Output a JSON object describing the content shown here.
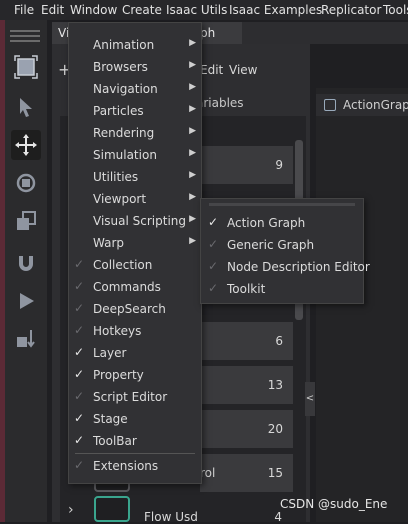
{
  "menubar": {
    "items": [
      "File",
      "Edit",
      "Window",
      "Create",
      "Isaac Utils",
      "Isaac Examples",
      "Replicator",
      "Tools"
    ]
  },
  "window_tab": {
    "title_left": "Vi",
    "title_right": "ph"
  },
  "pane": {
    "menu": [
      "Edit",
      "View"
    ],
    "variables_label": "ariables",
    "row_counts": [
      "9",
      "6",
      "13",
      "20",
      "15"
    ],
    "control_label": "rol",
    "flow_usd": {
      "name": "Flow Usd",
      "count": "4"
    },
    "collapse_arrow": "<"
  },
  "right_panel": {
    "tab_label": "ActionGraph"
  },
  "window_menu": {
    "items": [
      {
        "label": "Animation",
        "submenu": true,
        "checked": false
      },
      {
        "label": "Browsers",
        "submenu": true,
        "checked": false
      },
      {
        "label": "Navigation",
        "submenu": true,
        "checked": false
      },
      {
        "label": "Particles",
        "submenu": true,
        "checked": false
      },
      {
        "label": "Rendering",
        "submenu": true,
        "checked": false
      },
      {
        "label": "Simulation",
        "submenu": true,
        "checked": false
      },
      {
        "label": "Utilities",
        "submenu": true,
        "checked": false
      },
      {
        "label": "Viewport",
        "submenu": true,
        "checked": false
      },
      {
        "label": "Visual Scripting",
        "submenu": true,
        "checked": false
      },
      {
        "label": "Warp",
        "submenu": true,
        "checked": false
      },
      {
        "label": "Collection",
        "submenu": false,
        "checked": false
      },
      {
        "label": "Commands",
        "submenu": false,
        "checked": false
      },
      {
        "label": "DeepSearch",
        "submenu": false,
        "checked": false
      },
      {
        "label": "Hotkeys",
        "submenu": false,
        "checked": false
      },
      {
        "label": "Layer",
        "submenu": false,
        "checked": true
      },
      {
        "label": "Property",
        "submenu": false,
        "checked": true
      },
      {
        "label": "Script Editor",
        "submenu": false,
        "checked": false
      },
      {
        "label": "Stage",
        "submenu": false,
        "checked": true
      },
      {
        "label": "ToolBar",
        "submenu": false,
        "checked": true
      },
      {
        "label": "Extensions",
        "submenu": false,
        "checked": false
      }
    ]
  },
  "visual_scripting_submenu": {
    "items": [
      {
        "label": "Action Graph",
        "checked": true
      },
      {
        "label": "Generic Graph",
        "checked": false
      },
      {
        "label": "Node Description Editor",
        "checked": false
      },
      {
        "label": "Toolkit",
        "checked": false
      }
    ]
  },
  "watermark": "CSDN @sudo_Ene",
  "colors": {
    "menu_bg": "#313134",
    "menubar_bg": "#27272a",
    "accent_teal": "#3aa58e",
    "check_active": "#e8e8e8",
    "check_inactive": "#6a6a6e"
  },
  "icons": {
    "toolbar": [
      "cube-icon",
      "select-arrow-icon",
      "move-icon",
      "rotate-icon",
      "scale-icon",
      "snap-magnet-icon",
      "play-icon",
      "physics-icon"
    ]
  }
}
